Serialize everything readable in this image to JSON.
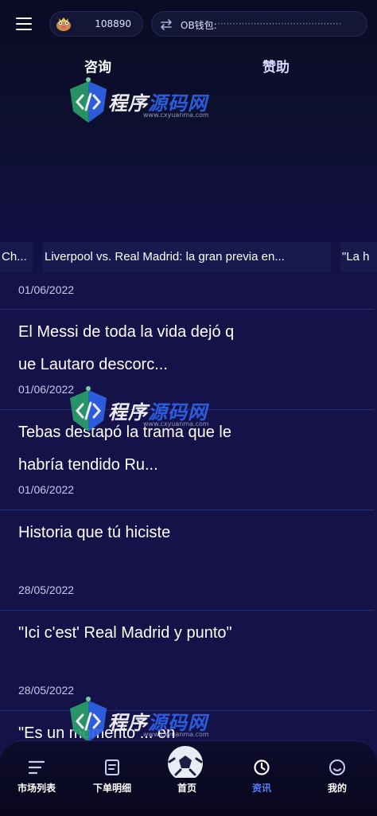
{
  "header": {
    "balance": "108890",
    "wallet_label": "OB钱包:",
    "wallet_address": "·········································"
  },
  "tabs": [
    {
      "label": "咨询"
    },
    {
      "label": "赞助"
    }
  ],
  "ticker": [
    {
      "text": "Ch..."
    },
    {
      "text": "Liverpool vs. Real Madrid: la gran previa en..."
    },
    {
      "text": "\"La h"
    }
  ],
  "news": [
    {
      "title": "",
      "date": "01/06/2022"
    },
    {
      "title": "El Messi de toda la vida dejó que Lautaro descorc...",
      "date": "01/06/2022"
    },
    {
      "title": "Tebas destapó la trama que le habría tendido Ru...",
      "date": "01/06/2022"
    },
    {
      "title": "Historia que tú hiciste",
      "date": "28/05/2022"
    },
    {
      "title": "\"Ici c'est' Real Madrid y punto\"",
      "date": "28/05/2022"
    },
    {
      "title": "\"Es un momento ... en",
      "date": ""
    }
  ],
  "watermark": {
    "text_a": "程序",
    "text_b": "源码网",
    "sub": "www.cxyuanma.com"
  },
  "bottom_nav": [
    {
      "label": "市场列表",
      "icon": "list-icon"
    },
    {
      "label": "下单明细",
      "icon": "order-icon"
    },
    {
      "label": "首页",
      "icon": "home-ball-icon"
    },
    {
      "label": "资讯",
      "icon": "clock-icon",
      "active": true
    },
    {
      "label": "我的",
      "icon": "profile-icon"
    }
  ],
  "colors": {
    "background": "#16124a",
    "active_tab": "#5b7cff",
    "card": "#151149"
  }
}
